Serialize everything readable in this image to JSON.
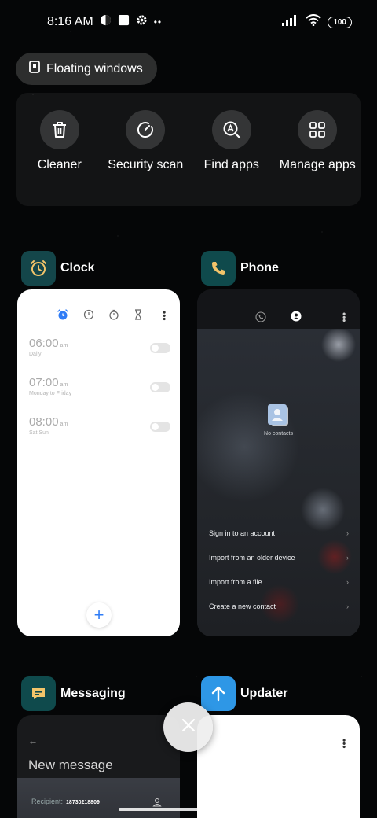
{
  "status_bar": {
    "time": "8:16 AM",
    "battery": "100"
  },
  "floating_windows_label": "Floating windows",
  "quick_actions": [
    {
      "label": "Cleaner",
      "icon": "trash-icon"
    },
    {
      "label": "Security scan",
      "icon": "security-scan-icon"
    },
    {
      "label": "Find apps",
      "icon": "find-apps-icon"
    },
    {
      "label": "Manage apps",
      "icon": "grid-icon"
    }
  ],
  "apps": {
    "clock": {
      "name": "Clock",
      "alarms": [
        {
          "time": "06:00",
          "ampm": "am",
          "days": "Daily"
        },
        {
          "time": "07:00",
          "ampm": "am",
          "days": "Monday to Friday"
        },
        {
          "time": "08:00",
          "ampm": "am",
          "days": "Sat Sun"
        }
      ]
    },
    "phone": {
      "name": "Phone",
      "empty_label": "No contacts",
      "options": [
        "Sign in to an account",
        "Import from an older device",
        "Import from a file",
        "Create a new contact"
      ]
    },
    "messaging": {
      "name": "Messaging",
      "title": "New message",
      "recipient_label": "Recipient:",
      "recipient_value": "18730218809"
    },
    "updater": {
      "name": "Updater"
    }
  },
  "colors": {
    "clock_icon_bg": "#14464a",
    "clock_icon_fg": "#f2c46a",
    "phone_icon_bg": "#0f4a4c",
    "messaging_icon_bg": "#0f4a4c",
    "updater_icon_bg": "#2e97e6",
    "clock_accent": "#2f7cf6"
  }
}
